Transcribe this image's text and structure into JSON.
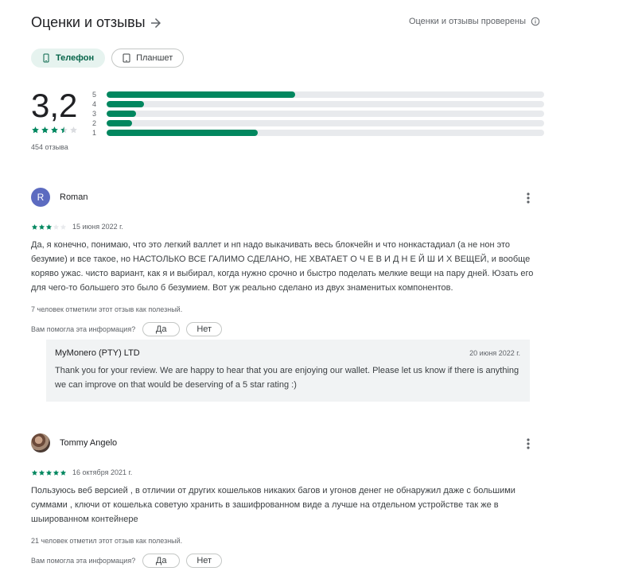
{
  "header": {
    "title": "Оценки и отзывы",
    "verified_label": "Оценки и отзывы проверены"
  },
  "device_tabs": [
    {
      "label": "Телефон",
      "icon": "phone-icon",
      "selected": true
    },
    {
      "label": "Планшет",
      "icon": "tablet-icon",
      "selected": false
    }
  ],
  "summary": {
    "score": "3,2",
    "stars_filled": 3.5,
    "count_label": "454 отзыва"
  },
  "histogram": [
    {
      "label": "5",
      "fraction": 0.43
    },
    {
      "label": "4",
      "fraction": 0.086
    },
    {
      "label": "3",
      "fraction": 0.068
    },
    {
      "label": "2",
      "fraction": 0.058
    },
    {
      "label": "1",
      "fraction": 0.345
    }
  ],
  "colors": {
    "accent": "#01875f",
    "star_empty": "#dadce0",
    "chip_active_bg": "#e6f3ef",
    "avatar_roman": "#5c6bc0"
  },
  "reviews": [
    {
      "author": "Roman",
      "avatar_letter": "R",
      "stars": 3,
      "date": "15 июня 2022 г.",
      "text": "Да, я конечно, понимаю, что это легкий валлет и нп надо выкачивать весь блокчейн и что нонкастадиал (а не нон это безумие) и все такое, но НАСТОЛЬКО ВСЕ ГАЛИМО СДЕЛАНО, НЕ ХВАТАЕТ О Ч Е В И Д Н Е Й Ш И Х ВЕЩЕЙ, и вообще коряво ужас. чисто вариант, как я и выбирал, когда нужно срочно и быстро поделать мелкие вещи на пару дней. Юзать его для чего-то большего это было б безумием. Вот уж реально сделано из двух знаменитых компонентов.",
      "helpful": "7 человек отметили этот отзыв как полезный.",
      "question": "Вам помогла эта информация?",
      "yes_label": "Да",
      "no_label": "Нет",
      "reply": {
        "author": "MyMonero (PTY) LTD",
        "date": "20 июня 2022 г.",
        "text": "Thank you for your review. We are happy to hear that you are enjoying our wallet. Please let us know if there is anything we can improve on that would be deserving of a 5 star rating :)"
      }
    },
    {
      "author": "Tommy Angelo",
      "stars": 5,
      "date": "16 октября 2021 г.",
      "text": "Пользуюсь веб версией , в отличии от других кошельков никаких багов и угонов денег не обнаружил даже с большими суммами , ключи от кошелька советую хранить в зашифрованном виде а лучше на отдельном устройстве так же в шыированном контейнере",
      "helpful": "21 человек отметил этот отзыв как полезный.",
      "question": "Вам помогла эта информация?",
      "yes_label": "Да",
      "no_label": "Нет"
    }
  ]
}
